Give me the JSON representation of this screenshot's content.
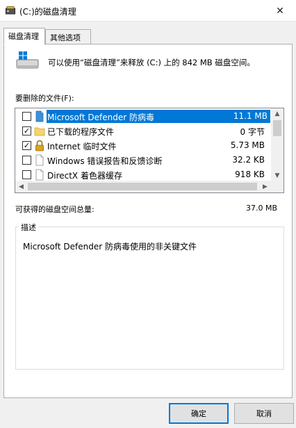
{
  "window": {
    "title": "(C:)的磁盘清理",
    "close_glyph": "✕"
  },
  "tabs": [
    {
      "label": "磁盘清理",
      "active": true
    },
    {
      "label": "其他选项",
      "active": false
    }
  ],
  "info_text": "可以使用“磁盘清理”来释放  (C:) 上的 842 MB 磁盘空间。",
  "files_label": "要删除的文件(F):",
  "files": [
    {
      "name": "Microsoft Defender 防病毒",
      "size": "11.1 MB",
      "checked": false,
      "icon": "defender-file-icon",
      "selected": true
    },
    {
      "name": "已下载的程序文件",
      "size": "0 字节",
      "checked": true,
      "icon": "folder-icon",
      "selected": false
    },
    {
      "name": "Internet 临时文件",
      "size": "5.73 MB",
      "checked": true,
      "icon": "lock-icon",
      "selected": false
    },
    {
      "name": "Windows 错误报告和反馈诊断",
      "size": "32.2 KB",
      "checked": false,
      "icon": "file-icon",
      "selected": false
    },
    {
      "name": "DirectX 着色器缓存",
      "size": "918 KB",
      "checked": false,
      "icon": "file-icon",
      "selected": false
    }
  ],
  "scroll_glyphs": {
    "up": "▲",
    "down": "▼",
    "left": "◀",
    "right": "▶"
  },
  "check_glyph": "✓",
  "total_label": "可获得的磁盘空间总量:",
  "total_value": "37.0 MB",
  "description": {
    "legend": "描述",
    "text": "Microsoft Defender 防病毒使用的非关键文件"
  },
  "buttons": {
    "ok": "确定",
    "cancel": "取消"
  },
  "colors": {
    "selection": "#0078d7",
    "folder": "#f6d36b",
    "lock": "#d9a521"
  }
}
